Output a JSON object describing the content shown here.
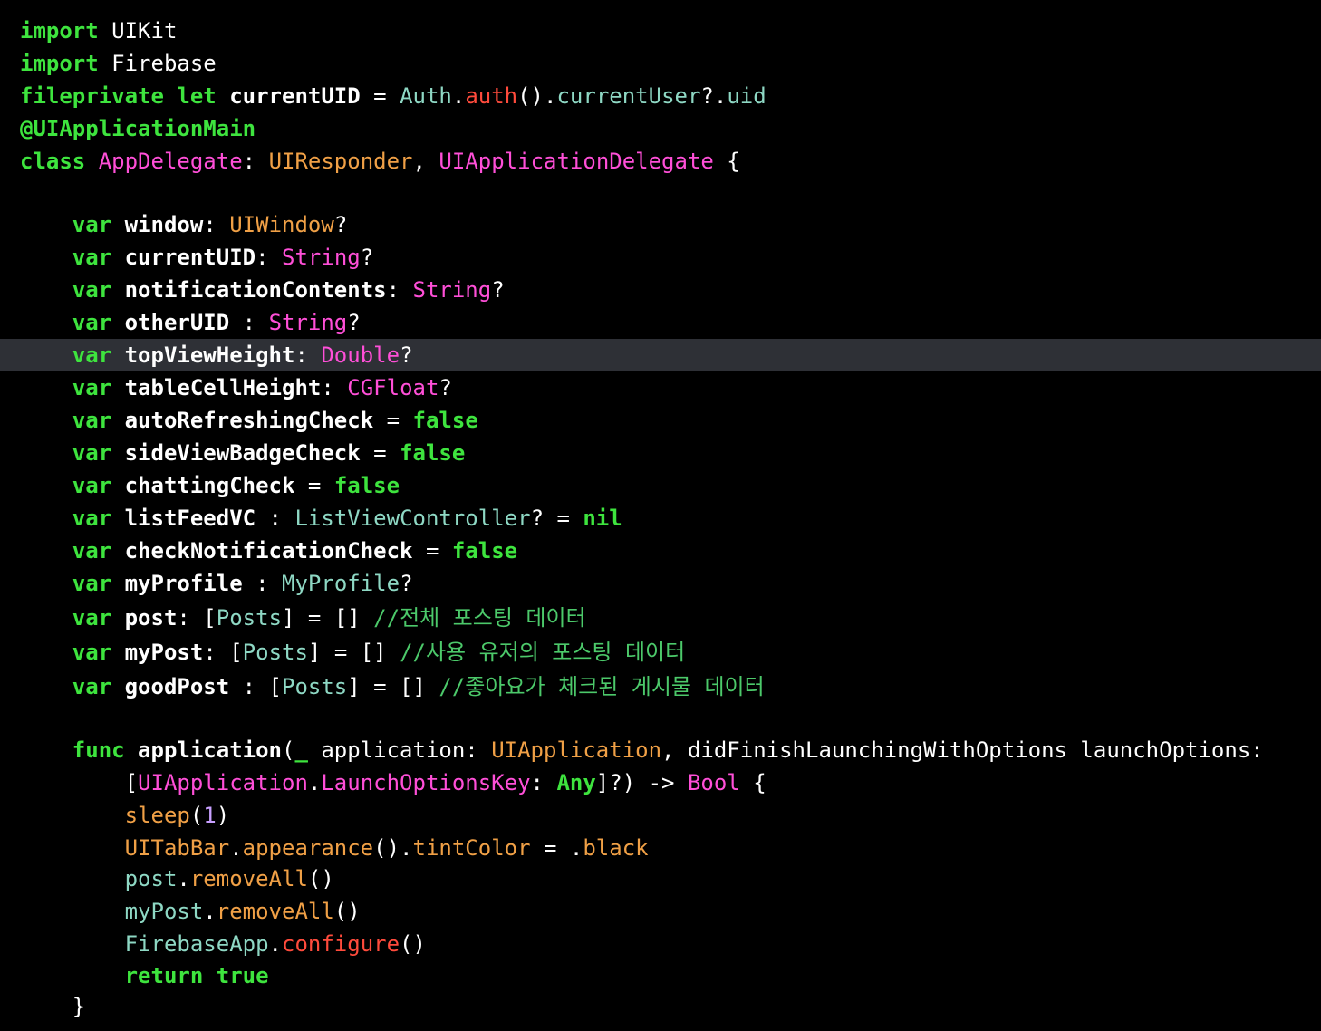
{
  "editor": {
    "highlight_line": 10,
    "indent": "    ",
    "colors": {
      "background": "#000000",
      "highlight": "#2e3036",
      "keyword": "#3ee43e",
      "plain": "#ffffff",
      "type_orange": "#f0a046",
      "type_pink": "#ff4fd8",
      "type_teal": "#8ed8c4",
      "method_red": "#ff4b3c",
      "comment": "#4cc96a",
      "number": "#c8a0ff"
    },
    "lines": [
      {
        "tokens": [
          {
            "t": "import",
            "c": "keyword",
            "b": true
          },
          {
            "t": " UIKit",
            "c": "plain"
          }
        ]
      },
      {
        "tokens": [
          {
            "t": "import",
            "c": "keyword",
            "b": true
          },
          {
            "t": " Firebase",
            "c": "plain"
          }
        ]
      },
      {
        "tokens": [
          {
            "t": "fileprivate let",
            "c": "keyword",
            "b": true
          },
          {
            "t": " ",
            "c": "plain"
          },
          {
            "t": "currentUID",
            "c": "plain",
            "b": true
          },
          {
            "t": " = ",
            "c": "plain"
          },
          {
            "t": "Auth",
            "c": "type_teal"
          },
          {
            "t": ".",
            "c": "plain"
          },
          {
            "t": "auth",
            "c": "method_red"
          },
          {
            "t": "().",
            "c": "plain"
          },
          {
            "t": "currentUser",
            "c": "type_teal"
          },
          {
            "t": "?.",
            "c": "plain"
          },
          {
            "t": "uid",
            "c": "type_teal"
          }
        ]
      },
      {
        "tokens": [
          {
            "t": "@UIApplicationMain",
            "c": "keyword",
            "b": true
          }
        ]
      },
      {
        "tokens": [
          {
            "t": "class",
            "c": "keyword",
            "b": true
          },
          {
            "t": " ",
            "c": "plain"
          },
          {
            "t": "AppDelegate",
            "c": "type_pink"
          },
          {
            "t": ": ",
            "c": "plain"
          },
          {
            "t": "UIResponder",
            "c": "type_orange"
          },
          {
            "t": ", ",
            "c": "plain"
          },
          {
            "t": "UIApplicationDelegate",
            "c": "type_pink"
          },
          {
            "t": " {",
            "c": "plain"
          }
        ]
      },
      {
        "tokens": []
      },
      {
        "tokens": [
          {
            "t": "    ",
            "c": "plain"
          },
          {
            "t": "var",
            "c": "keyword",
            "b": true
          },
          {
            "t": " ",
            "c": "plain"
          },
          {
            "t": "window",
            "c": "plain",
            "b": true
          },
          {
            "t": ": ",
            "c": "plain"
          },
          {
            "t": "UIWindow",
            "c": "type_orange"
          },
          {
            "t": "?",
            "c": "plain"
          }
        ]
      },
      {
        "tokens": [
          {
            "t": "    ",
            "c": "plain"
          },
          {
            "t": "var",
            "c": "keyword",
            "b": true
          },
          {
            "t": " ",
            "c": "plain"
          },
          {
            "t": "currentUID",
            "c": "plain",
            "b": true
          },
          {
            "t": ": ",
            "c": "plain"
          },
          {
            "t": "String",
            "c": "type_pink"
          },
          {
            "t": "?",
            "c": "plain"
          }
        ]
      },
      {
        "tokens": [
          {
            "t": "    ",
            "c": "plain"
          },
          {
            "t": "var",
            "c": "keyword",
            "b": true
          },
          {
            "t": " ",
            "c": "plain"
          },
          {
            "t": "notificationContents",
            "c": "plain",
            "b": true
          },
          {
            "t": ": ",
            "c": "plain"
          },
          {
            "t": "String",
            "c": "type_pink"
          },
          {
            "t": "?",
            "c": "plain"
          }
        ]
      },
      {
        "tokens": [
          {
            "t": "    ",
            "c": "plain"
          },
          {
            "t": "var",
            "c": "keyword",
            "b": true
          },
          {
            "t": " ",
            "c": "plain"
          },
          {
            "t": "otherUID",
            "c": "plain",
            "b": true
          },
          {
            "t": " : ",
            "c": "plain"
          },
          {
            "t": "String",
            "c": "type_pink"
          },
          {
            "t": "?",
            "c": "plain"
          }
        ]
      },
      {
        "tokens": [
          {
            "t": "    ",
            "c": "plain"
          },
          {
            "t": "var",
            "c": "keyword",
            "b": true
          },
          {
            "t": " ",
            "c": "plain"
          },
          {
            "t": "topViewHeight",
            "c": "plain",
            "b": true
          },
          {
            "t": ": ",
            "c": "plain"
          },
          {
            "t": "Double",
            "c": "type_pink"
          },
          {
            "t": "?",
            "c": "plain"
          }
        ]
      },
      {
        "tokens": [
          {
            "t": "    ",
            "c": "plain"
          },
          {
            "t": "var",
            "c": "keyword",
            "b": true
          },
          {
            "t": " ",
            "c": "plain"
          },
          {
            "t": "tableCellHeight",
            "c": "plain",
            "b": true
          },
          {
            "t": ": ",
            "c": "plain"
          },
          {
            "t": "CGFloat",
            "c": "type_pink"
          },
          {
            "t": "?",
            "c": "plain"
          }
        ]
      },
      {
        "tokens": [
          {
            "t": "    ",
            "c": "plain"
          },
          {
            "t": "var",
            "c": "keyword",
            "b": true
          },
          {
            "t": " ",
            "c": "plain"
          },
          {
            "t": "autoRefreshingCheck",
            "c": "plain",
            "b": true
          },
          {
            "t": " = ",
            "c": "plain"
          },
          {
            "t": "false",
            "c": "keyword",
            "b": true
          }
        ]
      },
      {
        "tokens": [
          {
            "t": "    ",
            "c": "plain"
          },
          {
            "t": "var",
            "c": "keyword",
            "b": true
          },
          {
            "t": " ",
            "c": "plain"
          },
          {
            "t": "sideViewBadgeCheck",
            "c": "plain",
            "b": true
          },
          {
            "t": " = ",
            "c": "plain"
          },
          {
            "t": "false",
            "c": "keyword",
            "b": true
          }
        ]
      },
      {
        "tokens": [
          {
            "t": "    ",
            "c": "plain"
          },
          {
            "t": "var",
            "c": "keyword",
            "b": true
          },
          {
            "t": " ",
            "c": "plain"
          },
          {
            "t": "chattingCheck",
            "c": "plain",
            "b": true
          },
          {
            "t": " = ",
            "c": "plain"
          },
          {
            "t": "false",
            "c": "keyword",
            "b": true
          }
        ]
      },
      {
        "tokens": [
          {
            "t": "    ",
            "c": "plain"
          },
          {
            "t": "var",
            "c": "keyword",
            "b": true
          },
          {
            "t": " ",
            "c": "plain"
          },
          {
            "t": "listFeedVC",
            "c": "plain",
            "b": true
          },
          {
            "t": " : ",
            "c": "plain"
          },
          {
            "t": "ListViewController",
            "c": "type_teal"
          },
          {
            "t": "? = ",
            "c": "plain"
          },
          {
            "t": "nil",
            "c": "keyword",
            "b": true
          }
        ]
      },
      {
        "tokens": [
          {
            "t": "    ",
            "c": "plain"
          },
          {
            "t": "var",
            "c": "keyword",
            "b": true
          },
          {
            "t": " ",
            "c": "plain"
          },
          {
            "t": "checkNotificationCheck",
            "c": "plain",
            "b": true
          },
          {
            "t": " = ",
            "c": "plain"
          },
          {
            "t": "false",
            "c": "keyword",
            "b": true
          }
        ]
      },
      {
        "tokens": [
          {
            "t": "    ",
            "c": "plain"
          },
          {
            "t": "var",
            "c": "keyword",
            "b": true
          },
          {
            "t": " ",
            "c": "plain"
          },
          {
            "t": "myProfile",
            "c": "plain",
            "b": true
          },
          {
            "t": " : ",
            "c": "plain"
          },
          {
            "t": "MyProfile",
            "c": "type_teal"
          },
          {
            "t": "?",
            "c": "plain"
          }
        ]
      },
      {
        "tokens": [
          {
            "t": "    ",
            "c": "plain"
          },
          {
            "t": "var",
            "c": "keyword",
            "b": true
          },
          {
            "t": " ",
            "c": "plain"
          },
          {
            "t": "post",
            "c": "plain",
            "b": true
          },
          {
            "t": ": [",
            "c": "plain"
          },
          {
            "t": "Posts",
            "c": "type_teal"
          },
          {
            "t": "] = [] ",
            "c": "plain"
          },
          {
            "t": "//전체 포스팅 데이터",
            "c": "comment"
          }
        ]
      },
      {
        "tokens": [
          {
            "t": "    ",
            "c": "plain"
          },
          {
            "t": "var",
            "c": "keyword",
            "b": true
          },
          {
            "t": " ",
            "c": "plain"
          },
          {
            "t": "myPost",
            "c": "plain",
            "b": true
          },
          {
            "t": ": [",
            "c": "plain"
          },
          {
            "t": "Posts",
            "c": "type_teal"
          },
          {
            "t": "] = [] ",
            "c": "plain"
          },
          {
            "t": "//사용 유저의 포스팅 데이터",
            "c": "comment"
          }
        ]
      },
      {
        "tokens": [
          {
            "t": "    ",
            "c": "plain"
          },
          {
            "t": "var",
            "c": "keyword",
            "b": true
          },
          {
            "t": " ",
            "c": "plain"
          },
          {
            "t": "goodPost",
            "c": "plain",
            "b": true
          },
          {
            "t": " : [",
            "c": "plain"
          },
          {
            "t": "Posts",
            "c": "type_teal"
          },
          {
            "t": "] = [] ",
            "c": "plain"
          },
          {
            "t": "//좋아요가 체크된 게시물 데이터",
            "c": "comment"
          }
        ]
      },
      {
        "tokens": []
      },
      {
        "tokens": [
          {
            "t": "    ",
            "c": "plain"
          },
          {
            "t": "func",
            "c": "keyword",
            "b": true
          },
          {
            "t": " ",
            "c": "plain"
          },
          {
            "t": "application",
            "c": "plain",
            "b": true
          },
          {
            "t": "(",
            "c": "plain"
          },
          {
            "t": "_",
            "c": "keyword",
            "b": true
          },
          {
            "t": " application: ",
            "c": "plain"
          },
          {
            "t": "UIApplication",
            "c": "type_orange"
          },
          {
            "t": ", didFinishLaunchingWithOptions launchOptions:",
            "c": "plain"
          }
        ]
      },
      {
        "tokens": [
          {
            "t": "        [",
            "c": "plain"
          },
          {
            "t": "UIApplication",
            "c": "type_pink"
          },
          {
            "t": ".",
            "c": "plain"
          },
          {
            "t": "LaunchOptionsKey",
            "c": "type_pink"
          },
          {
            "t": ": ",
            "c": "plain"
          },
          {
            "t": "Any",
            "c": "keyword",
            "b": true
          },
          {
            "t": "]?) -> ",
            "c": "plain"
          },
          {
            "t": "Bool",
            "c": "type_pink"
          },
          {
            "t": " {",
            "c": "plain"
          }
        ]
      },
      {
        "tokens": [
          {
            "t": "        ",
            "c": "plain"
          },
          {
            "t": "sleep",
            "c": "type_orange"
          },
          {
            "t": "(",
            "c": "plain"
          },
          {
            "t": "1",
            "c": "number"
          },
          {
            "t": ")",
            "c": "plain"
          }
        ]
      },
      {
        "tokens": [
          {
            "t": "        ",
            "c": "plain"
          },
          {
            "t": "UITabBar",
            "c": "type_orange"
          },
          {
            "t": ".",
            "c": "plain"
          },
          {
            "t": "appearance",
            "c": "type_orange"
          },
          {
            "t": "().",
            "c": "plain"
          },
          {
            "t": "tintColor",
            "c": "type_orange"
          },
          {
            "t": " = .",
            "c": "plain"
          },
          {
            "t": "black",
            "c": "type_orange"
          }
        ]
      },
      {
        "tokens": [
          {
            "t": "        ",
            "c": "plain"
          },
          {
            "t": "post",
            "c": "type_teal"
          },
          {
            "t": ".",
            "c": "plain"
          },
          {
            "t": "removeAll",
            "c": "type_orange"
          },
          {
            "t": "()",
            "c": "plain"
          }
        ]
      },
      {
        "tokens": [
          {
            "t": "        ",
            "c": "plain"
          },
          {
            "t": "myPost",
            "c": "type_teal"
          },
          {
            "t": ".",
            "c": "plain"
          },
          {
            "t": "removeAll",
            "c": "type_orange"
          },
          {
            "t": "()",
            "c": "plain"
          }
        ]
      },
      {
        "tokens": [
          {
            "t": "        ",
            "c": "plain"
          },
          {
            "t": "FirebaseApp",
            "c": "type_teal"
          },
          {
            "t": ".",
            "c": "plain"
          },
          {
            "t": "configure",
            "c": "method_red"
          },
          {
            "t": "()",
            "c": "plain"
          }
        ]
      },
      {
        "tokens": [
          {
            "t": "        ",
            "c": "plain"
          },
          {
            "t": "return true",
            "c": "keyword",
            "b": true
          }
        ]
      },
      {
        "tokens": [
          {
            "t": "    }",
            "c": "plain"
          }
        ]
      }
    ]
  }
}
